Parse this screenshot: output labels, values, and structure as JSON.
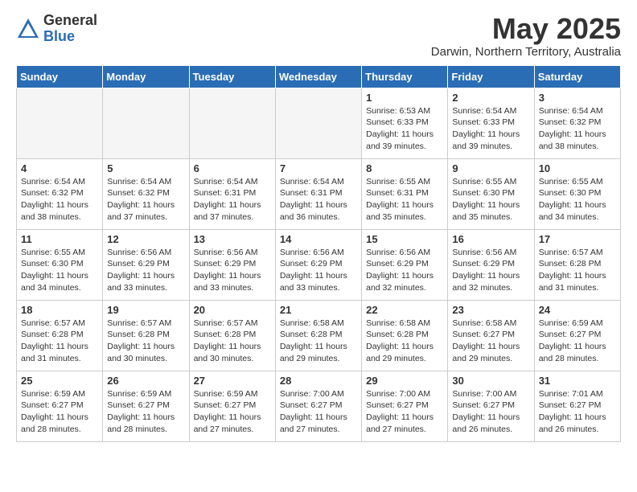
{
  "logo": {
    "general": "General",
    "blue": "Blue"
  },
  "title": "May 2025",
  "subtitle": "Darwin, Northern Territory, Australia",
  "days_header": [
    "Sunday",
    "Monday",
    "Tuesday",
    "Wednesday",
    "Thursday",
    "Friday",
    "Saturday"
  ],
  "weeks": [
    [
      {
        "num": "",
        "info": "",
        "empty": true
      },
      {
        "num": "",
        "info": "",
        "empty": true
      },
      {
        "num": "",
        "info": "",
        "empty": true
      },
      {
        "num": "",
        "info": "",
        "empty": true
      },
      {
        "num": "1",
        "info": "Sunrise: 6:53 AM\nSunset: 6:33 PM\nDaylight: 11 hours\nand 39 minutes."
      },
      {
        "num": "2",
        "info": "Sunrise: 6:54 AM\nSunset: 6:33 PM\nDaylight: 11 hours\nand 39 minutes."
      },
      {
        "num": "3",
        "info": "Sunrise: 6:54 AM\nSunset: 6:32 PM\nDaylight: 11 hours\nand 38 minutes."
      }
    ],
    [
      {
        "num": "4",
        "info": "Sunrise: 6:54 AM\nSunset: 6:32 PM\nDaylight: 11 hours\nand 38 minutes."
      },
      {
        "num": "5",
        "info": "Sunrise: 6:54 AM\nSunset: 6:32 PM\nDaylight: 11 hours\nand 37 minutes."
      },
      {
        "num": "6",
        "info": "Sunrise: 6:54 AM\nSunset: 6:31 PM\nDaylight: 11 hours\nand 37 minutes."
      },
      {
        "num": "7",
        "info": "Sunrise: 6:54 AM\nSunset: 6:31 PM\nDaylight: 11 hours\nand 36 minutes."
      },
      {
        "num": "8",
        "info": "Sunrise: 6:55 AM\nSunset: 6:31 PM\nDaylight: 11 hours\nand 35 minutes."
      },
      {
        "num": "9",
        "info": "Sunrise: 6:55 AM\nSunset: 6:30 PM\nDaylight: 11 hours\nand 35 minutes."
      },
      {
        "num": "10",
        "info": "Sunrise: 6:55 AM\nSunset: 6:30 PM\nDaylight: 11 hours\nand 34 minutes."
      }
    ],
    [
      {
        "num": "11",
        "info": "Sunrise: 6:55 AM\nSunset: 6:30 PM\nDaylight: 11 hours\nand 34 minutes."
      },
      {
        "num": "12",
        "info": "Sunrise: 6:56 AM\nSunset: 6:29 PM\nDaylight: 11 hours\nand 33 minutes."
      },
      {
        "num": "13",
        "info": "Sunrise: 6:56 AM\nSunset: 6:29 PM\nDaylight: 11 hours\nand 33 minutes."
      },
      {
        "num": "14",
        "info": "Sunrise: 6:56 AM\nSunset: 6:29 PM\nDaylight: 11 hours\nand 33 minutes."
      },
      {
        "num": "15",
        "info": "Sunrise: 6:56 AM\nSunset: 6:29 PM\nDaylight: 11 hours\nand 32 minutes."
      },
      {
        "num": "16",
        "info": "Sunrise: 6:56 AM\nSunset: 6:29 PM\nDaylight: 11 hours\nand 32 minutes."
      },
      {
        "num": "17",
        "info": "Sunrise: 6:57 AM\nSunset: 6:28 PM\nDaylight: 11 hours\nand 31 minutes."
      }
    ],
    [
      {
        "num": "18",
        "info": "Sunrise: 6:57 AM\nSunset: 6:28 PM\nDaylight: 11 hours\nand 31 minutes."
      },
      {
        "num": "19",
        "info": "Sunrise: 6:57 AM\nSunset: 6:28 PM\nDaylight: 11 hours\nand 30 minutes."
      },
      {
        "num": "20",
        "info": "Sunrise: 6:57 AM\nSunset: 6:28 PM\nDaylight: 11 hours\nand 30 minutes."
      },
      {
        "num": "21",
        "info": "Sunrise: 6:58 AM\nSunset: 6:28 PM\nDaylight: 11 hours\nand 29 minutes."
      },
      {
        "num": "22",
        "info": "Sunrise: 6:58 AM\nSunset: 6:28 PM\nDaylight: 11 hours\nand 29 minutes."
      },
      {
        "num": "23",
        "info": "Sunrise: 6:58 AM\nSunset: 6:27 PM\nDaylight: 11 hours\nand 29 minutes."
      },
      {
        "num": "24",
        "info": "Sunrise: 6:59 AM\nSunset: 6:27 PM\nDaylight: 11 hours\nand 28 minutes."
      }
    ],
    [
      {
        "num": "25",
        "info": "Sunrise: 6:59 AM\nSunset: 6:27 PM\nDaylight: 11 hours\nand 28 minutes."
      },
      {
        "num": "26",
        "info": "Sunrise: 6:59 AM\nSunset: 6:27 PM\nDaylight: 11 hours\nand 28 minutes."
      },
      {
        "num": "27",
        "info": "Sunrise: 6:59 AM\nSunset: 6:27 PM\nDaylight: 11 hours\nand 27 minutes."
      },
      {
        "num": "28",
        "info": "Sunrise: 7:00 AM\nSunset: 6:27 PM\nDaylight: 11 hours\nand 27 minutes."
      },
      {
        "num": "29",
        "info": "Sunrise: 7:00 AM\nSunset: 6:27 PM\nDaylight: 11 hours\nand 27 minutes."
      },
      {
        "num": "30",
        "info": "Sunrise: 7:00 AM\nSunset: 6:27 PM\nDaylight: 11 hours\nand 26 minutes."
      },
      {
        "num": "31",
        "info": "Sunrise: 7:01 AM\nSunset: 6:27 PM\nDaylight: 11 hours\nand 26 minutes."
      }
    ]
  ]
}
